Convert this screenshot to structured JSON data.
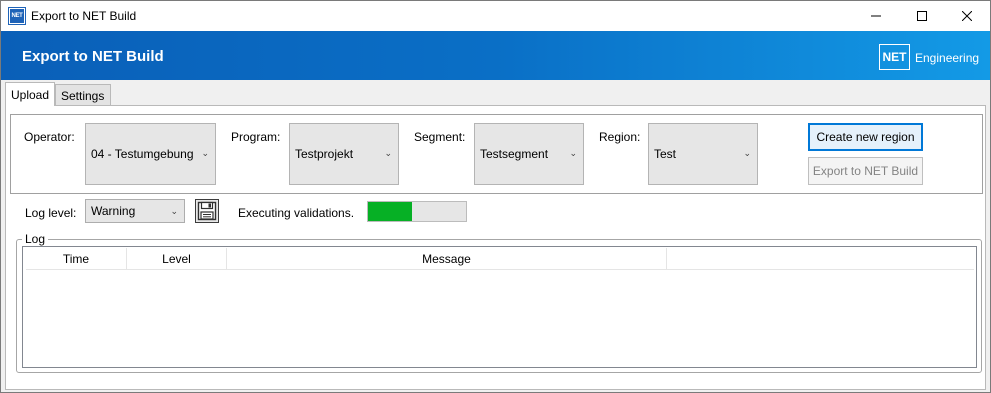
{
  "window": {
    "title": "Export to NET Build",
    "icon_label": "NET"
  },
  "banner": {
    "title": "Export to NET Build",
    "logo_box": "NET",
    "logo_text": "Engineering"
  },
  "tabs": [
    {
      "label": "Upload",
      "active": true
    },
    {
      "label": "Settings",
      "active": false
    }
  ],
  "selection": {
    "operator": {
      "label": "Operator:",
      "value": "04 - Testumgebung"
    },
    "program": {
      "label": "Program:",
      "value": "Testprojekt"
    },
    "segment": {
      "label": "Segment:",
      "value": "Testsegment"
    },
    "region": {
      "label": "Region:",
      "value": "Test"
    },
    "create_region_label": "Create new region",
    "export_label": "Export to NET Build"
  },
  "log_level": {
    "label": "Log level:",
    "value": "Warning"
  },
  "status": {
    "text": "Executing validations.",
    "progress": 0.45
  },
  "log": {
    "title": "Log",
    "columns": [
      "Time",
      "Level",
      "Message",
      ""
    ]
  },
  "colors": {
    "banner_start": "#0a5fb8",
    "banner_end": "#139ae6",
    "progress": "#06b025",
    "accent": "#0078d7"
  },
  "icons": {
    "save": "floppy-disk-icon",
    "dropdown": "chevron-down-icon",
    "minimize": "minimize-icon",
    "maximize": "maximize-icon",
    "close": "close-icon"
  }
}
